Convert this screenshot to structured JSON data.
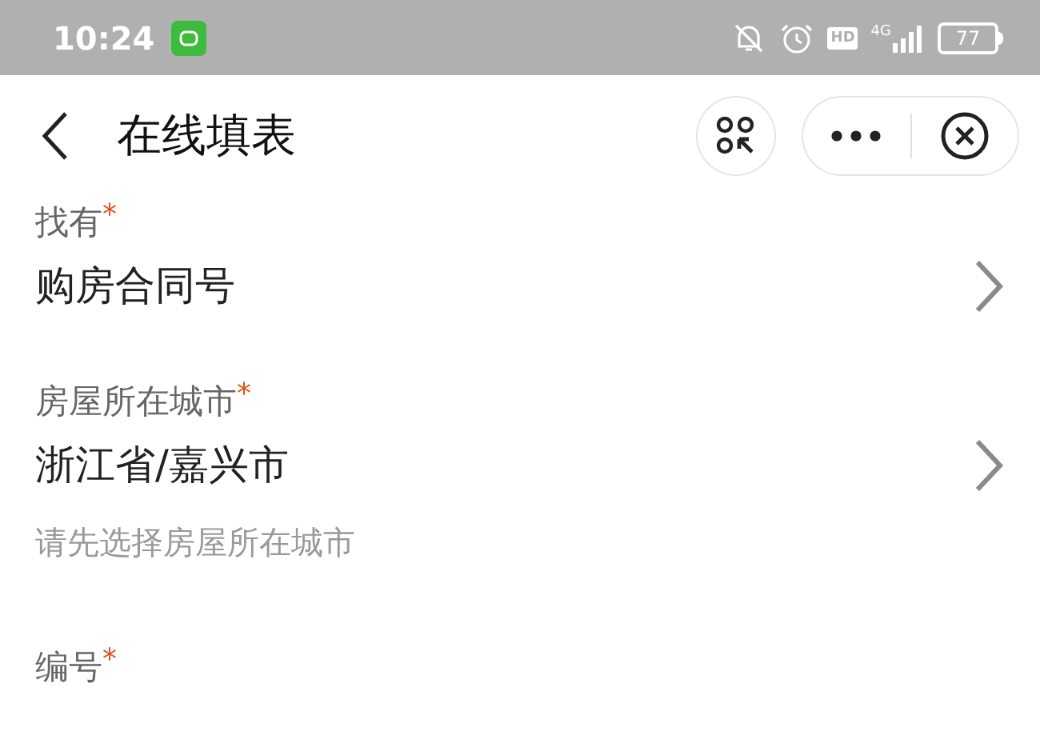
{
  "status_bar": {
    "time": "10:24",
    "network": "4G",
    "hd": "HD",
    "battery": "77"
  },
  "nav": {
    "title": "在线填表"
  },
  "fields": [
    {
      "kind": "select",
      "label": "找有",
      "required_mark": "*",
      "value": "购房合同号"
    },
    {
      "kind": "select",
      "label": "房屋所在城市",
      "required_mark": "*",
      "value": "浙江省/嘉兴市",
      "hint": "请先选择房屋所在城市"
    },
    {
      "kind": "text",
      "label": "编号",
      "required_mark": "*"
    }
  ]
}
